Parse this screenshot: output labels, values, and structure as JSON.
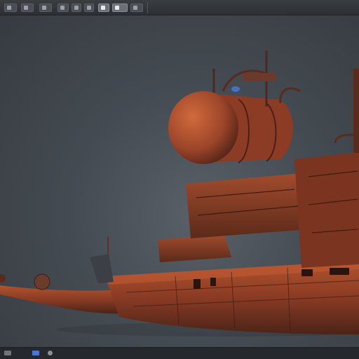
{
  "toolbar": {
    "buttons": [
      {
        "icon": "menu-icon"
      },
      {
        "icon": "select-icon"
      },
      {
        "icon": "move-icon"
      },
      {
        "icon": "rotate-icon"
      },
      {
        "icon": "scale-icon"
      },
      {
        "icon": "render-icon"
      },
      {
        "icon": "camera-icon"
      },
      {
        "icon": "light-icon"
      },
      {
        "icon": "settings-icon"
      }
    ]
  },
  "viewport": {
    "background_color": "#454b52",
    "model_primary_color": "#8a3b24",
    "model_accent_color": "#b2532e"
  },
  "statusbar": {
    "icons": [
      "object-icon",
      "layers-icon",
      "search-icon"
    ],
    "accent_color": "#4a76d6"
  }
}
